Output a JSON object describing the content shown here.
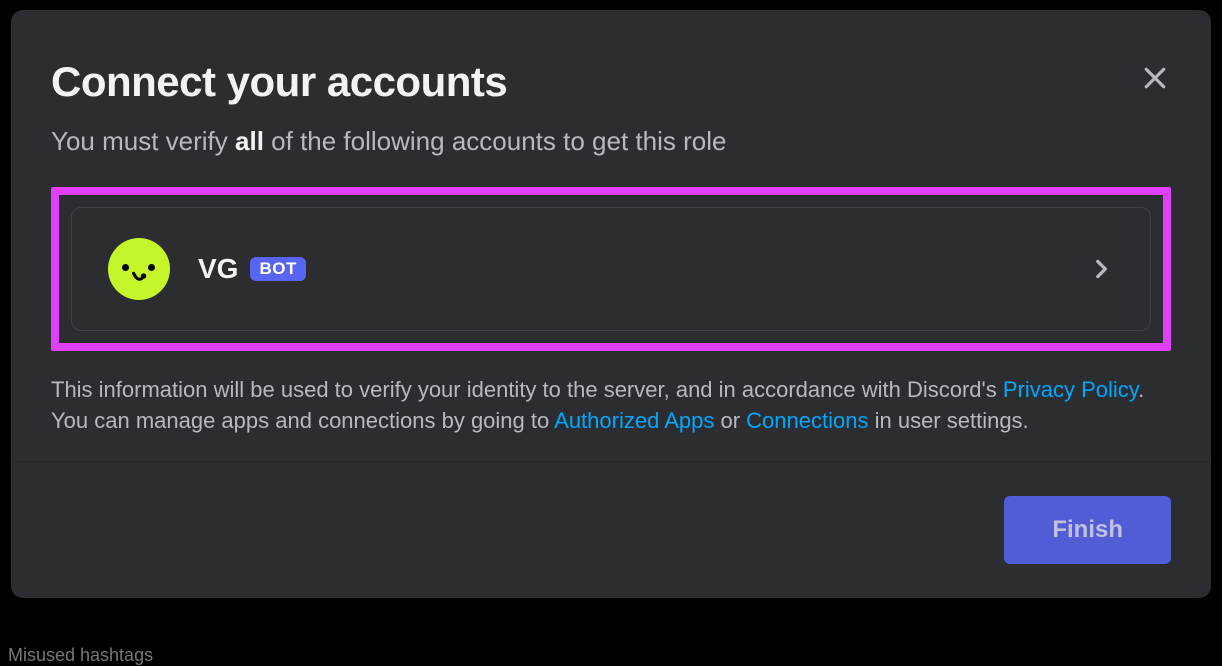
{
  "modal": {
    "title": "Connect your accounts",
    "subtitle_pre": "You must verify ",
    "subtitle_bold": "all",
    "subtitle_post": " of the following accounts to get this role"
  },
  "account": {
    "name": "VG",
    "badge": "BOT"
  },
  "disclaimer": {
    "text_1": "This information will be used to verify your identity to the server, and in accordance with Discord's ",
    "link_1": "Privacy Policy",
    "text_2": ". You can manage apps and connections by going to ",
    "link_2": "Authorized Apps",
    "text_3": " or ",
    "link_3": "Connections",
    "text_4": " in user settings."
  },
  "footer": {
    "finish_label": "Finish"
  },
  "bg": {
    "text": "Misused hashtags"
  }
}
